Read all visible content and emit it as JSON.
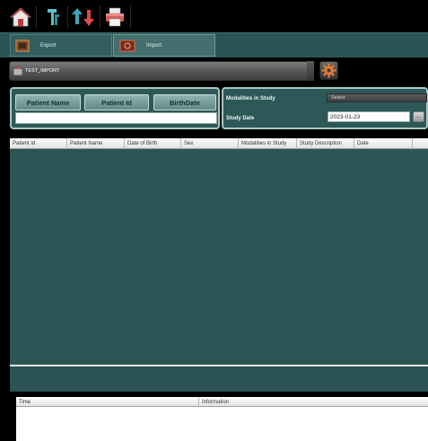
{
  "toolbar": {
    "icons": [
      "home-icon",
      "query-icon",
      "transfer-icon",
      "print-icon"
    ]
  },
  "tabs": [
    {
      "label": "Export",
      "active": false
    },
    {
      "label": "Import",
      "active": true
    }
  ],
  "profile": {
    "name": "TEST_IMPORT"
  },
  "search": {
    "buttons": [
      "Patient Name",
      "Patient Id",
      "BirthDate"
    ],
    "input_value": "",
    "modalities_label": "Modalities in Study",
    "modalities_select": "Select",
    "study_date_label": "Study Date",
    "study_date_value": "2023-01-23",
    "dots_label": "..."
  },
  "grid": {
    "columns": [
      "Patient Id",
      "Patient Name",
      "Date of Birth",
      "Sex",
      "Modalities in Study",
      "Study Description",
      "Date"
    ],
    "rows": []
  },
  "log": {
    "columns": [
      "Time",
      "Information"
    ],
    "rows": []
  },
  "colors": {
    "accent": "#2d5858",
    "panel_border": "#a7c6c4",
    "button": "#7aa3a0"
  }
}
